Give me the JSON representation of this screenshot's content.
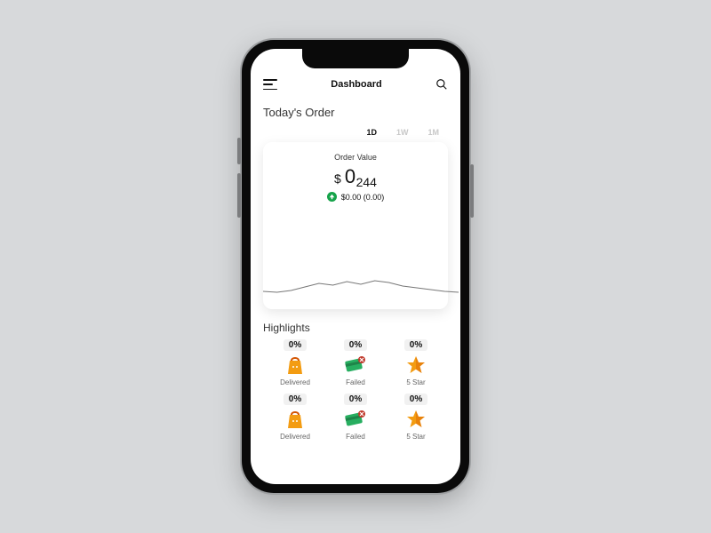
{
  "header": {
    "title": "Dashboard"
  },
  "section": {
    "title": "Today's Order"
  },
  "tabs": {
    "d": "1D",
    "w": "1W",
    "m": "1M"
  },
  "card": {
    "label": "Order Value",
    "currency": "$",
    "value_main": "0",
    "value_sub": "244",
    "delta_text": "$0.00 (0.00)"
  },
  "chart_data": {
    "type": "line",
    "title": "Order Value",
    "xlabel": "",
    "ylabel": "",
    "x": [
      0,
      1,
      2,
      3,
      4,
      5,
      6,
      7,
      8,
      9,
      10,
      11,
      12,
      13,
      14
    ],
    "values": [
      0.12,
      0.1,
      0.14,
      0.22,
      0.3,
      0.26,
      0.34,
      0.28,
      0.36,
      0.32,
      0.24,
      0.2,
      0.16,
      0.12,
      0.1
    ],
    "ylim": [
      0,
      1
    ]
  },
  "highlights": {
    "title": "Highlights",
    "row1": [
      {
        "pct": "0%",
        "label": "Delivered",
        "icon": "bag"
      },
      {
        "pct": "0%",
        "label": "Failed",
        "icon": "card-fail"
      },
      {
        "pct": "0%",
        "label": "5 Star",
        "icon": "star"
      }
    ],
    "row2": [
      {
        "pct": "0%",
        "label": "Delivered",
        "icon": "bag"
      },
      {
        "pct": "0%",
        "label": "Failed",
        "icon": "card-fail"
      },
      {
        "pct": "0%",
        "label": "5 Star",
        "icon": "star"
      }
    ]
  },
  "icons": {
    "bag_fill": "#f39c12",
    "card_fill": "#27ae60",
    "card_ribbon": "#c0392b",
    "star_fill": "#f39c12",
    "star_shadow": "#d35400"
  }
}
